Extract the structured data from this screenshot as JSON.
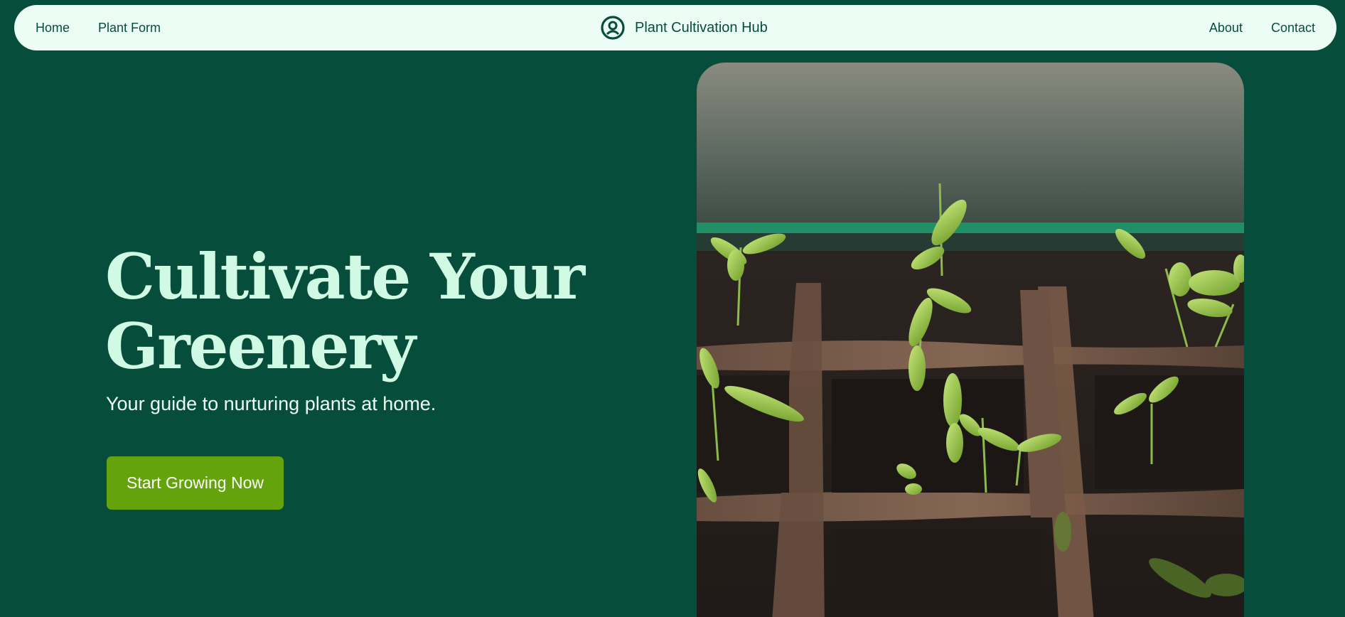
{
  "nav": {
    "left_links": [
      "Home",
      "Plant Form"
    ],
    "brand_text": "Plant Cultivation Hub",
    "brand_icon": "plant-hub-logo-icon",
    "right_links": [
      "About",
      "Contact"
    ]
  },
  "hero": {
    "title": "Cultivate Your Greenery",
    "subtitle": "Your guide to nurturing plants at home.",
    "cta_label": "Start Growing Now",
    "image": "seedlings-photo"
  },
  "colors": {
    "background": "#064e3b",
    "nav_background": "#ecfdf5",
    "title": "#d1fae5",
    "accent_button": "#65a30d"
  }
}
